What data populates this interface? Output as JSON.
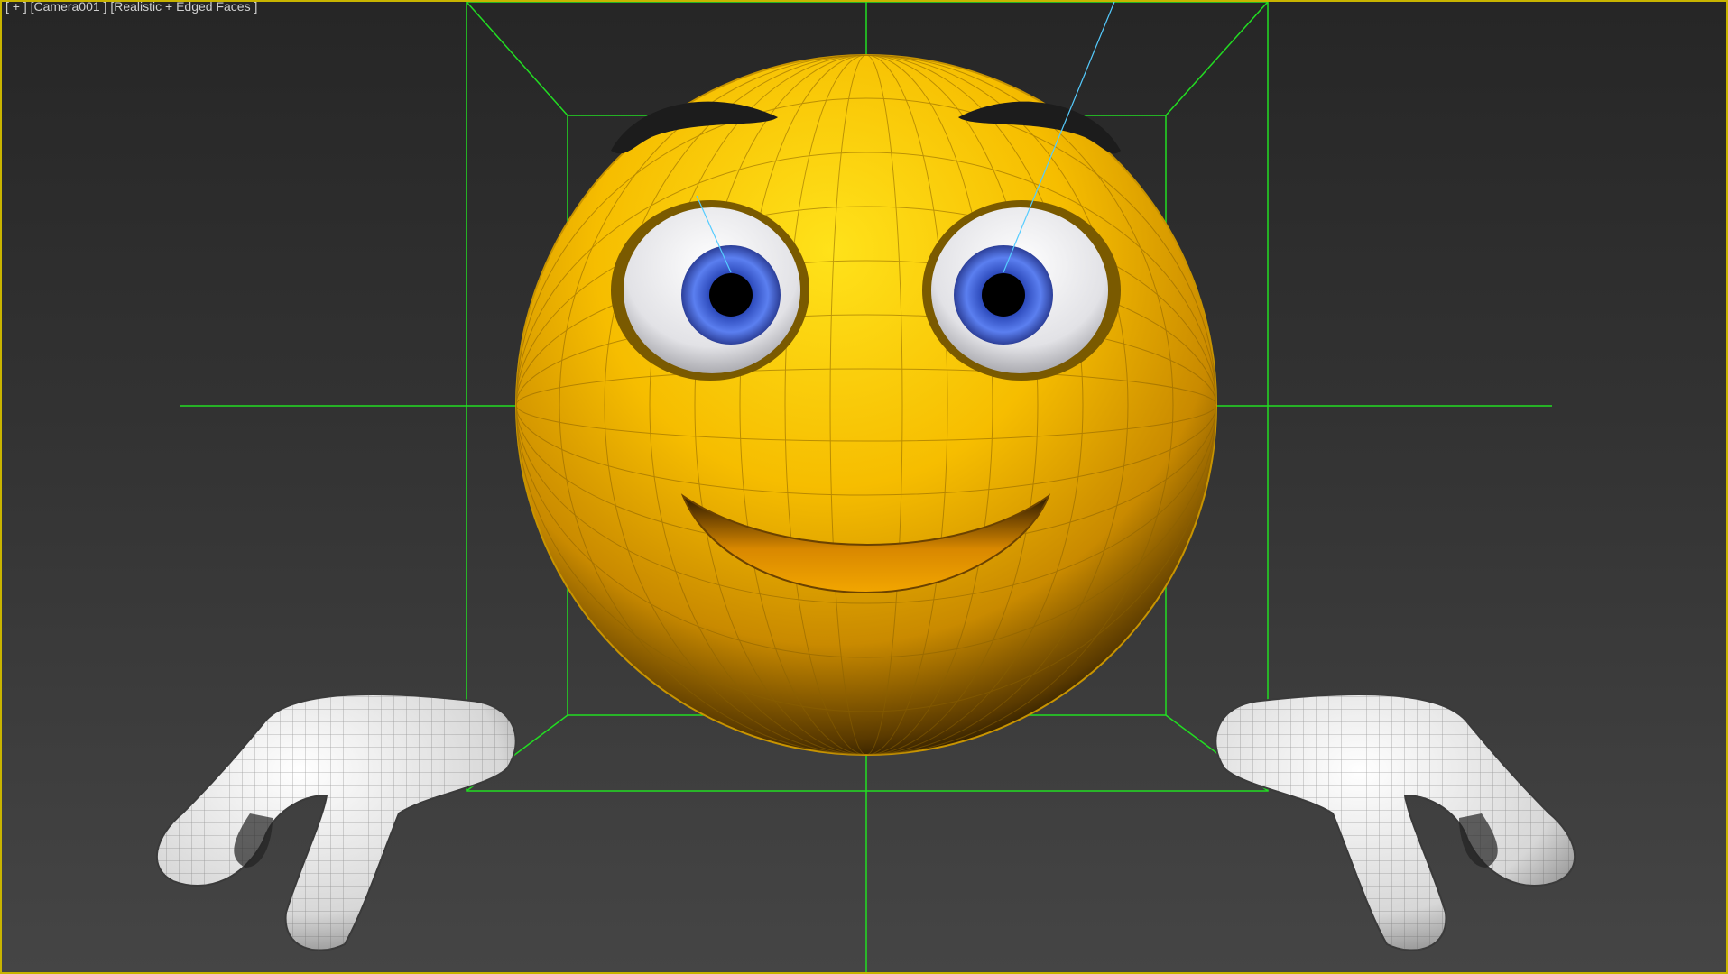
{
  "viewport": {
    "label_plus": "[ + ]",
    "label_camera": "[Camera001 ]",
    "label_shading": "[Realistic + Edged Faces ]",
    "colors": {
      "border": "#c8b400",
      "frustum": "#22dd22",
      "target_line": "#55ccff",
      "head": "#f5c000",
      "iris": "#3a5fd0"
    }
  },
  "scene": {
    "objects": [
      "head",
      "left-eye",
      "right-eye",
      "left-brow",
      "right-brow",
      "mouth",
      "left-hand",
      "right-hand",
      "camera-frustum"
    ]
  }
}
